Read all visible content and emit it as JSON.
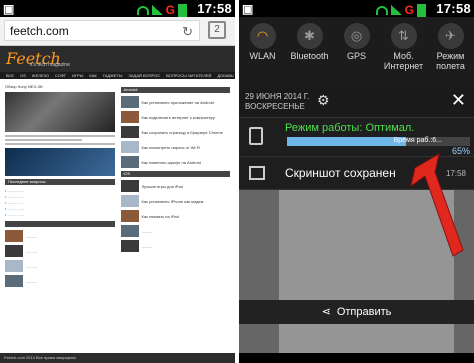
{
  "status": {
    "carrier_mark": "G",
    "time": "17:58"
  },
  "browser": {
    "url": "feetch.com",
    "tab_count": "2"
  },
  "website": {
    "logo_text": "Feetch",
    "tagline": "it's tech magazine",
    "nav_items": [
      "ВСЕ",
      "OS",
      "ЖЕЛЕЗО",
      "СОФТ",
      "ИГРЫ",
      "КАК",
      "ГАДЖЕТЫ",
      "ЗАДАЙ ВОПРОС",
      "ВОПРОСЫ ЧИТАТЕЛЕЙ",
      "ДОБАВЬ"
    ],
    "left_block_title": "Обзор Sony NEX-3N",
    "left_section": "Последние вопросы",
    "right_section": "Android",
    "right_items": [
      "Как установить приложение на Android",
      "Как подключить интернет к компьютеру",
      "Как сохранить страницу в браузере Chrome",
      "Как посмотреть пароль от Wi-Fi",
      "Как поменять шрифт на Android"
    ],
    "ios_section": "iOS",
    "ios_items": [
      "Лучшие игры для iPad",
      "Как установить iPhone как модем",
      "Как снимать на iPad"
    ],
    "footer": "Feetch.com 2014 Все права защищены"
  },
  "shade": {
    "toggles": [
      {
        "label": "WLAN",
        "on": true
      },
      {
        "label": "Bluetooth",
        "on": false
      },
      {
        "label": "GPS",
        "on": false
      },
      {
        "label": "Моб. Интернет",
        "on": false
      },
      {
        "label": "Режим полета",
        "on": false
      }
    ],
    "date": "29 ИЮНЯ 2014 Г.",
    "weekday": "ВОСКРЕСЕНЬЕ",
    "notification_work": {
      "title": "Режим работы: Оптимал.",
      "subtitle": "Время раб.:6...",
      "percent": "65%",
      "progress": 0.65
    },
    "notification_screenshot": {
      "title": "Скриншот сохранен",
      "time": "17:58"
    },
    "send_label": "Отправить"
  },
  "colors": {
    "accent_orange": "#ffa41a",
    "green": "#4ce04c",
    "progress_blue": "#6fb6e8",
    "arrow_red": "#e0281e"
  }
}
